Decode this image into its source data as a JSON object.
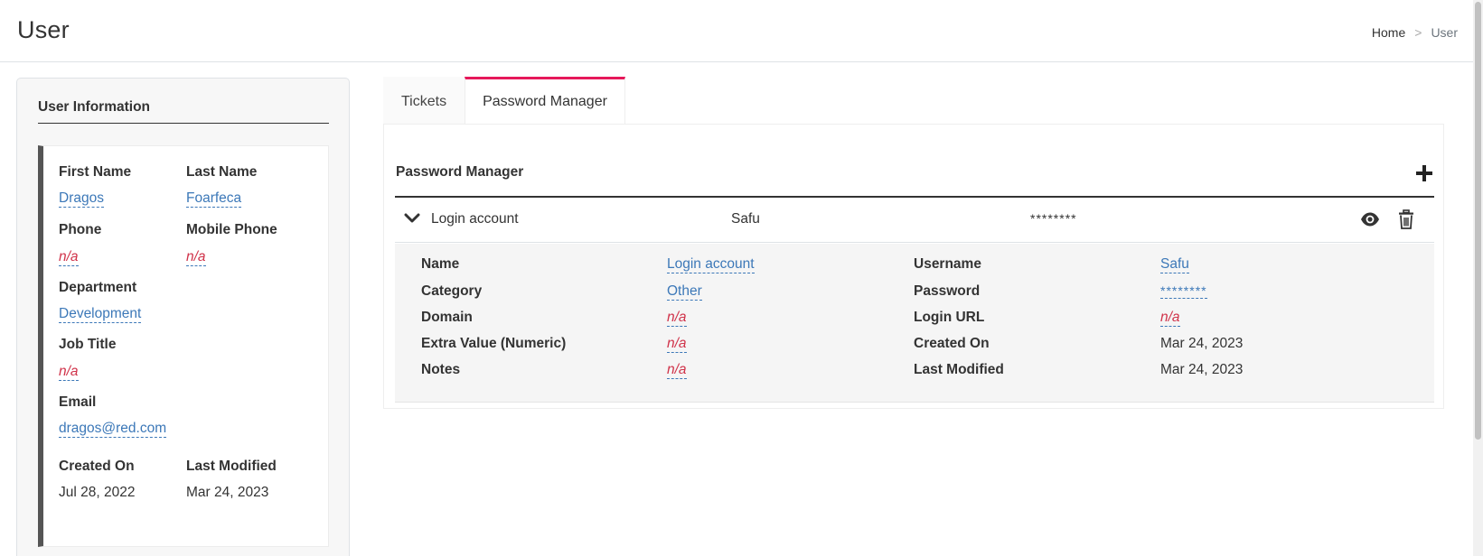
{
  "header": {
    "title": "User",
    "breadcrumb": {
      "home": "Home",
      "separator": ">",
      "current": "User"
    }
  },
  "user_info": {
    "title": "User Information",
    "first_name_label": "First Name",
    "first_name": "Dragos",
    "last_name_label": "Last Name",
    "last_name": "Foarfeca",
    "phone_label": "Phone",
    "phone": "n/a",
    "mobile_phone_label": "Mobile Phone",
    "mobile_phone": "n/a",
    "department_label": "Department",
    "department": "Development",
    "job_title_label": "Job Title",
    "job_title": "n/a",
    "email_label": "Email",
    "email": "dragos@red.com",
    "created_on_label": "Created On",
    "created_on": "Jul 28, 2022",
    "last_modified_label": "Last Modified",
    "last_modified": "Mar 24, 2023"
  },
  "tabs": [
    {
      "label": "Tickets",
      "active": false
    },
    {
      "label": "Password Manager",
      "active": true
    }
  ],
  "password_manager": {
    "title": "Password Manager",
    "add_icon": "plus-icon",
    "entry": {
      "name": "Login account",
      "username": "Safu",
      "password_masked": "********",
      "expand_icon": "chevron-down-icon",
      "view_icon": "eye-icon",
      "delete_icon": "trash-icon"
    },
    "details": {
      "name_label": "Name",
      "name": "Login account",
      "category_label": "Category",
      "category": "Other",
      "domain_label": "Domain",
      "domain": "n/a",
      "extra_value_label": "Extra Value (Numeric)",
      "extra_value": "n/a",
      "notes_label": "Notes",
      "notes": "n/a",
      "username_label": "Username",
      "username": "Safu",
      "password_label": "Password",
      "password": "********",
      "login_url_label": "Login URL",
      "login_url": "n/a",
      "created_on_label": "Created On",
      "created_on": "Mar 24, 2023",
      "last_modified_label": "Last Modified",
      "last_modified": "Mar 24, 2023"
    }
  },
  "colors": {
    "link": "#3c78b8",
    "na": "#d0334a",
    "active_tab_accent": "#e6185a",
    "panel_stripe": "#555555"
  }
}
